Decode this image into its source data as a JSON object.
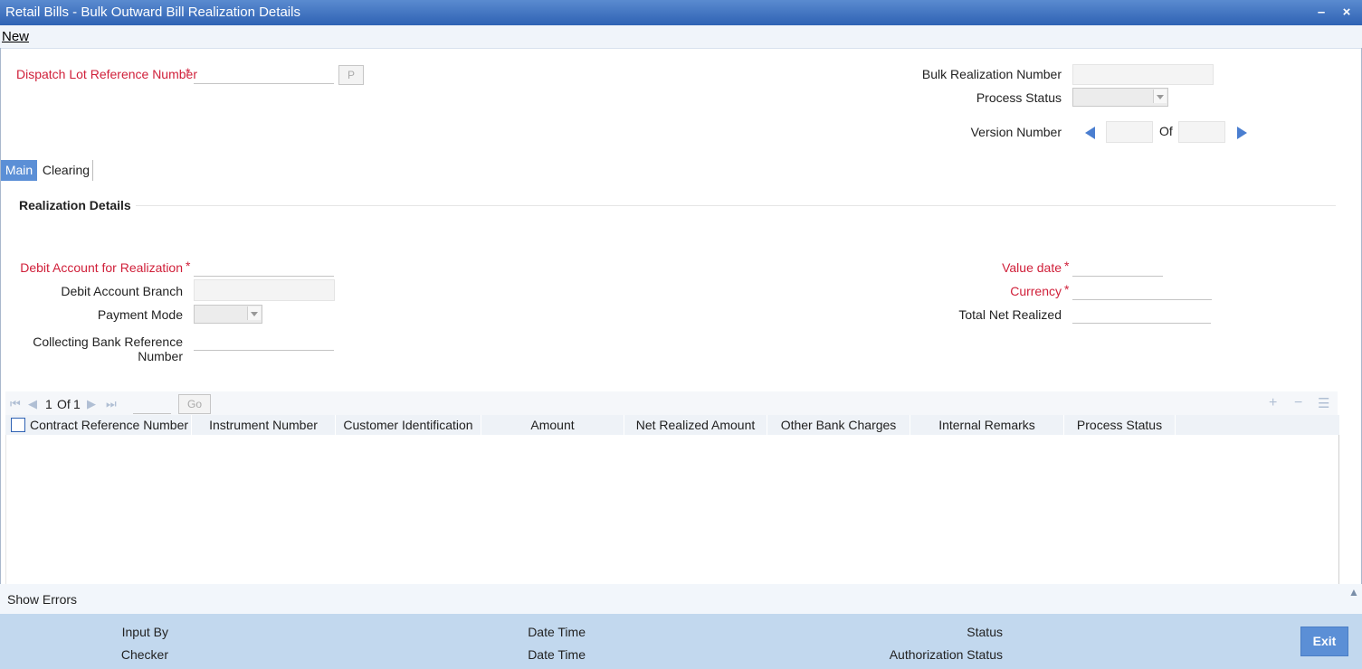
{
  "window": {
    "title": "Retail Bills - Bulk Outward Bill Realization Details",
    "minimize": "–",
    "close": "×"
  },
  "toolbar": {
    "new_label": "New"
  },
  "header": {
    "dispatch_lot_label": "Dispatch Lot Reference Number",
    "p_button": "P",
    "bulk_realization_label": "Bulk Realization Number",
    "process_status_label": "Process Status",
    "version_number_label": "Version Number",
    "of_label": "Of"
  },
  "tabs": [
    {
      "label": "Main",
      "active": true
    },
    {
      "label": "Clearing",
      "active": false
    }
  ],
  "realization": {
    "section_title": "Realization Details",
    "debit_account_label": "Debit Account for Realization",
    "debit_branch_label": "Debit Account Branch",
    "payment_mode_label": "Payment Mode",
    "collecting_ref_label_1": "Collecting Bank Reference",
    "collecting_ref_label_2": "Number",
    "value_date_label": "Value date",
    "currency_label": "Currency",
    "total_net_label": "Total Net Realized",
    "required_mark": "*"
  },
  "grid": {
    "page_current": "1",
    "page_of": "Of",
    "page_total": "1",
    "go_label": "Go",
    "columns": [
      "Contract Reference Number",
      "Instrument Number",
      "Customer Identification",
      "Amount",
      "Net Realized Amount",
      "Other Bank Charges",
      "Internal Remarks",
      "Process Status"
    ]
  },
  "errors": {
    "label": "Show Errors"
  },
  "footer": {
    "input_by": "Input By",
    "checker": "Checker",
    "date_time_1": "Date Time",
    "date_time_2": "Date Time",
    "status": "Status",
    "auth_status": "Authorization Status",
    "exit_label": "Exit"
  },
  "colors": {
    "accent": "#5b8fd6",
    "required": "#d0203a",
    "footer": "#c2d8ee"
  },
  "icons": [
    "minimize-icon",
    "close-icon",
    "prev-version-icon",
    "next-version-icon",
    "first-page-icon",
    "prev-page-icon",
    "next-page-icon",
    "last-page-icon",
    "add-row-icon",
    "delete-row-icon",
    "single-view-icon",
    "scroll-up-icon"
  ]
}
